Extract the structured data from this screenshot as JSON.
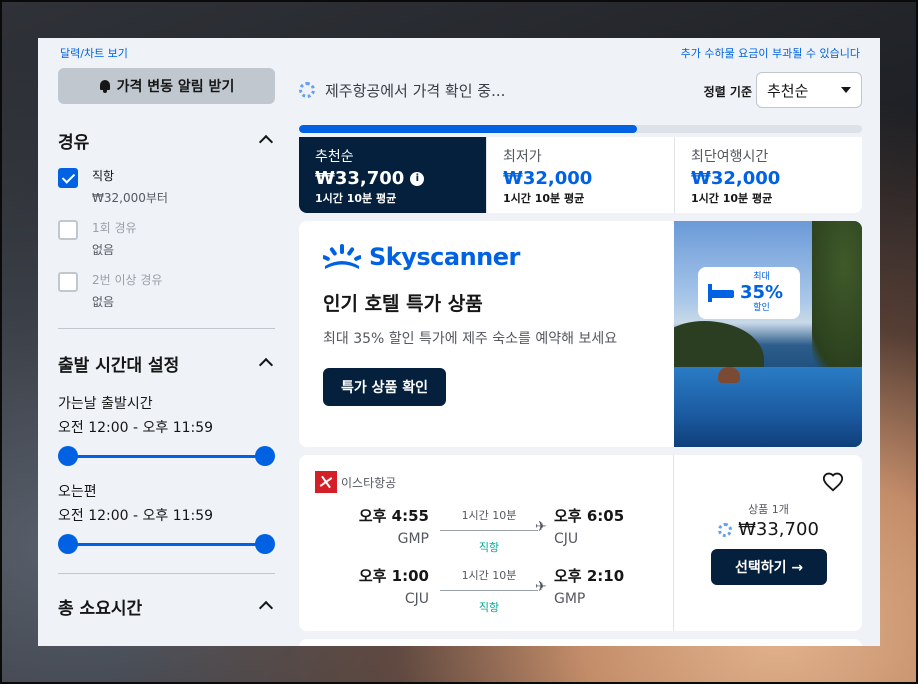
{
  "top_links": {
    "left": "달력/차트 보기",
    "right": "추가 수하물 요금이 부과될 수 있습니다"
  },
  "sidebar": {
    "alert_button": "가격 변동 알림 받기",
    "stops": {
      "title": "경유",
      "options": [
        {
          "label": "직항",
          "sub": "₩32,000부터",
          "checked": true,
          "enabled": true
        },
        {
          "label": "1회 경유",
          "sub": "없음",
          "checked": false,
          "enabled": false
        },
        {
          "label": "2번 이상 경유",
          "sub": "없음",
          "checked": false,
          "enabled": false
        }
      ]
    },
    "departure_times": {
      "title": "출발 시간대 설정",
      "outbound_label": "가는날 출발시간",
      "outbound_range": "오전 12:00 - 오후 11:59",
      "return_label": "오는편",
      "return_range": "오전 12:00 - 오후 11:59"
    },
    "duration": {
      "title": "총 소요시간"
    }
  },
  "main": {
    "status_text": "제주항공에서 가격 확인 중...",
    "sort_label": "정렬 기준",
    "sort_value": "추천순",
    "progress_percent": 60,
    "sort_tabs": [
      {
        "name": "추천순",
        "price": "₩33,700",
        "sub": "1시간 10분 평균",
        "active": true
      },
      {
        "name": "최저가",
        "price": "₩32,000",
        "sub": "1시간 10분 평균",
        "active": false
      },
      {
        "name": "최단여행시간",
        "price": "₩32,000",
        "sub": "1시간 10분 평균",
        "active": false
      }
    ],
    "promo": {
      "brand": "Skyscanner",
      "title": "인기 호텔 특가 상품",
      "description": "최대 35% 할인 특가에 제주 숙소를 예약해 보세요",
      "button": "특가 상품 확인",
      "badge_top": "최대",
      "badge_value": "35%",
      "badge_bottom": "할인"
    },
    "result": {
      "airline": "이스타항공",
      "legs": [
        {
          "dep_time": "오후 4:55",
          "dep_code": "GMP",
          "duration": "1시간 10분",
          "stops": "직항",
          "arr_time": "오후 6:05",
          "arr_code": "CJU"
        },
        {
          "dep_time": "오후 1:00",
          "dep_code": "CJU",
          "duration": "1시간 10분",
          "stops": "직항",
          "arr_time": "오후 2:10",
          "arr_code": "GMP"
        }
      ],
      "deals": "상품 1개",
      "price": "₩33,700",
      "select_button": "선택하기 →"
    }
  },
  "colors": {
    "accent": "#0062e3",
    "dark": "#05203c",
    "direct": "#00a698"
  }
}
